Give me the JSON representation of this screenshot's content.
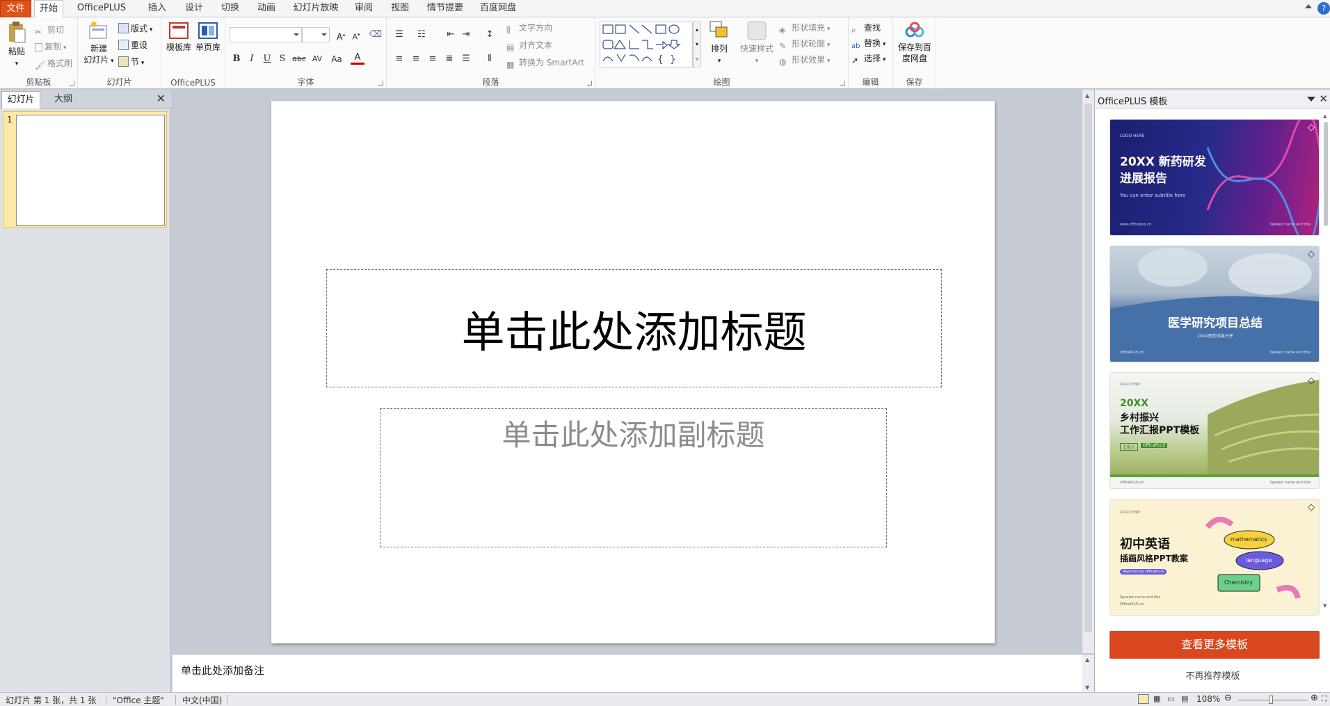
{
  "tabs": {
    "file": "文件",
    "home": "开始",
    "officeplus": "OfficePLUS",
    "insert": "插入",
    "design": "设计",
    "transitions": "切换",
    "animations": "动画",
    "slideshow": "幻灯片放映",
    "review": "审阅",
    "view": "视图",
    "storyboard": "情节提要",
    "baidupan": "百度网盘"
  },
  "ribbon": {
    "clipboard": {
      "label": "剪贴板",
      "paste": "粘贴",
      "cut": "剪切",
      "copy": "复制",
      "format_painter": "格式刷"
    },
    "slides": {
      "label": "幻灯片",
      "new_slide_1": "新建",
      "new_slide_2": "幻灯片",
      "layout": "版式",
      "reset": "重设",
      "section": "节"
    },
    "officeplus": {
      "label": "OfficePLUS",
      "template_lib": "模板库",
      "single_page_lib": "单页库"
    },
    "font": {
      "label": "字体"
    },
    "paragraph": {
      "label": "段落",
      "text_direction": "文字方向",
      "align_text": "对齐文本",
      "convert_smartart": "转换为 SmartArt"
    },
    "drawing": {
      "label": "绘图",
      "arrange": "排列",
      "quick_styles": "快速样式",
      "shape_fill": "形状填充",
      "shape_outline": "形状轮廓",
      "shape_effects": "形状效果"
    },
    "editing": {
      "label": "编辑",
      "find": "查找",
      "replace": "替换",
      "select": "选择"
    },
    "save": {
      "label": "保存",
      "save_to_baidu_1": "保存到百",
      "save_to_baidu_2": "度网盘"
    }
  },
  "left_pane": {
    "tab_slides": "幻灯片",
    "tab_outline": "大纲",
    "slide_number": "1"
  },
  "slide": {
    "title_placeholder": "单击此处添加标题",
    "subtitle_placeholder": "单击此处添加副标题"
  },
  "notes": {
    "placeholder": "单击此处添加备注"
  },
  "right_pane": {
    "title": "OfficePLUS 模板",
    "templates": [
      {
        "logo": "LOGO HERE",
        "title_1": "20XX 新药研发",
        "title_2": "进展报告",
        "subtitle": "You can enter subtitle here",
        "footer_left": "www.officeplus.cn",
        "footer_right": "Speaker name and title"
      },
      {
        "title": "医学研究项目总结",
        "subtitle": "20XX医药成果分享",
        "footer_left": "OfficePLUS.cn",
        "footer_right": "Speaker name and title"
      },
      {
        "logo": "LOGO HERE",
        "title_1": "20XX",
        "title_2": "乡村振兴",
        "title_3": "工作汇报PPT模板",
        "tag_1": "汇报人",
        "tag_2": "OfficePLUS",
        "footer_left": "OfficePLUS.cn",
        "footer_right": "Speaker name and title"
      },
      {
        "logo": "LOGO HERE",
        "title_1": "初中英语",
        "title_2": "插画风格PPT教案",
        "badge": "Reported by OfficePLUS",
        "bubble_1": "mathematics",
        "bubble_2": "language",
        "bubble_3": "Chemistry",
        "footer_1": "Speaker name and title",
        "footer_2": "OfficePLUS.cn"
      }
    ],
    "more_button": "查看更多模板",
    "no_recommend": "不再推荐模板"
  },
  "status": {
    "slide_info": "幻灯片 第 1 张，共 1 张",
    "theme": "\"Office 主题\"",
    "language": "中文(中国)",
    "zoom": "108%"
  },
  "colors": {
    "file_tab": "#e0521b",
    "accent_button": "#d9471e",
    "thumb_highlight": "#fce9a8"
  }
}
